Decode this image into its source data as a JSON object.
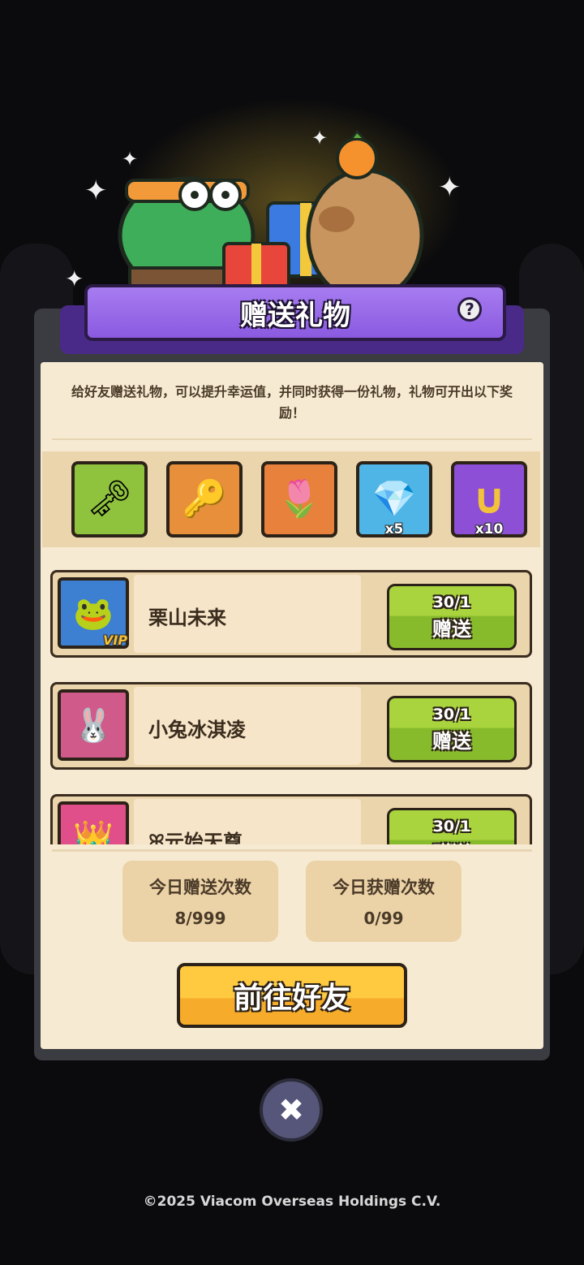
{
  "dialog": {
    "title": "赠送礼物",
    "help_icon": "question-icon",
    "help_label": "?",
    "description": "给好友赠送礼物，可以提升幸运值，并同时获得一份礼物，礼物可开出以下奖励！"
  },
  "rewards": [
    {
      "icon": "silver-key-icon",
      "glyph": "🗝",
      "count": "",
      "color": "#8fc23d"
    },
    {
      "icon": "gold-key-icon",
      "glyph": "🔑",
      "count": "",
      "color": "#e88f3b"
    },
    {
      "icon": "flower-key-icon",
      "glyph": "🌷",
      "count": "",
      "color": "#e8813b"
    },
    {
      "icon": "crystal-icon",
      "glyph": "💎",
      "count": "x5",
      "color": "#4fb5e6"
    },
    {
      "icon": "horseshoe-icon",
      "glyph": "∪",
      "count": "x10",
      "color": "#8d4fd6"
    }
  ],
  "friends": [
    {
      "name": "栗山未来",
      "vip": "VIP",
      "avatar_icon": "frog-avatar-icon",
      "avatar_color": "#3d7fd1",
      "send_count": "30/1",
      "send_label": "赠送"
    },
    {
      "name": "小兔冰淇凌",
      "vip": "",
      "avatar_icon": "bunny-avatar-icon",
      "avatar_color": "#d05a8a",
      "send_count": "30/1",
      "send_label": "赠送"
    },
    {
      "name": "ꕤ元始天尊",
      "vip": "",
      "avatar_icon": "crown-avatar-icon",
      "avatar_color": "#e04f8a",
      "send_count": "30/1",
      "send_label": "赠送"
    }
  ],
  "stats": {
    "sent_label": "今日赠送次数",
    "sent_value": "8/999",
    "received_label": "今日获赠次数",
    "received_value": "0/99"
  },
  "goto_button": "前往好友",
  "close_icon": "close-icon",
  "close_label": "✖",
  "copyright": "©2025 Viacom Overseas Holdings C.V."
}
